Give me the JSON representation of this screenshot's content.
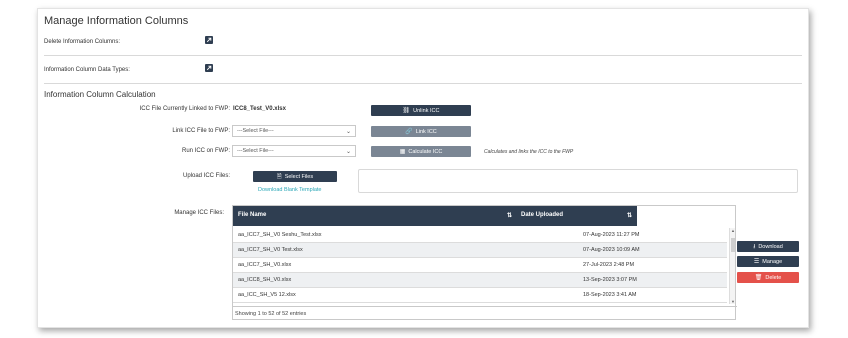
{
  "page": {
    "title": "Manage Information Columns",
    "delete_label": "Delete Information Columns:",
    "datatypes_label": "Information Column Data Types:",
    "calc_title": "Information Column Calculation"
  },
  "calc": {
    "linked_label": "ICC File Currently Linked to FWP:",
    "linked_value": "ICC8_Test_V0.xlsx",
    "link_label": "Link ICC File to FWP:",
    "run_label": "Run ICC on FWP:",
    "select_placeholder": "---Select File---",
    "unlink_btn": "Unlink ICC",
    "link_btn": "Link ICC",
    "calculate_btn": "Calculate ICC",
    "calc_note": "Calculates and links the ICC to the FWP",
    "upload_label": "Upload ICC Files:",
    "select_files_btn": "Select Files",
    "download_template": "Download Blank Template"
  },
  "manage": {
    "label": "Manage ICC Files:",
    "columns": [
      "File Name",
      "Date Uploaded"
    ],
    "rows": [
      {
        "name": "aa_ICC7_SH_V0 Seshu_Test.xlsx",
        "date": "07-Aug-2023 11:27 PM"
      },
      {
        "name": "aa_ICC7_SH_V0 Test.xlsx",
        "date": "07-Aug-2023 10:09 AM"
      },
      {
        "name": "aa_ICC7_SH_V0.xlsx",
        "date": "27-Jul-2023 2:48 PM"
      },
      {
        "name": "aa_ICC8_SH_V0.xlsx",
        "date": "13-Sep-2023 3:07 PM"
      },
      {
        "name": "aa_ICC_SH_V5 12.xlsx",
        "date": "18-Sep-2023 3:41 AM"
      }
    ],
    "footer": "Showing 1 to 52 of 52 entries",
    "download_btn": "Download",
    "manage_btn": "Manage",
    "delete_btn": "Delete"
  },
  "colors": {
    "dark": "#2f3e51",
    "gray": "#7b8694",
    "red": "#e4514a",
    "link": "#2aa7b7"
  }
}
